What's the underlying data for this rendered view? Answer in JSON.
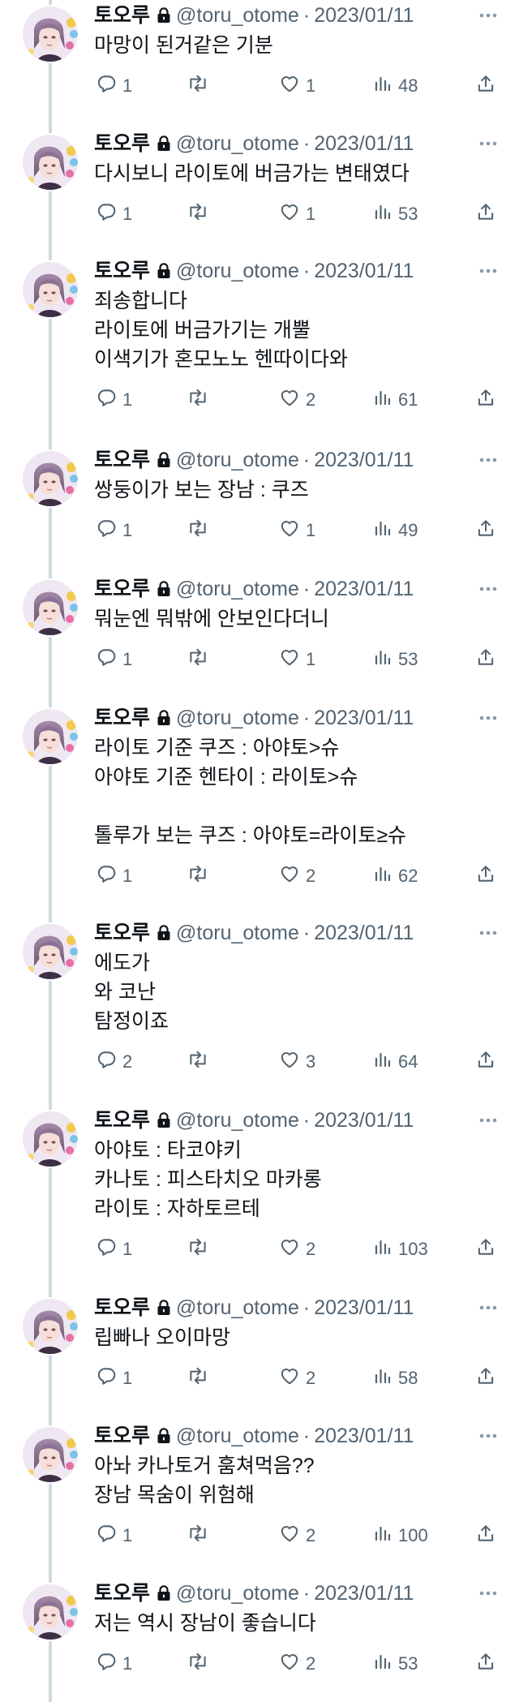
{
  "colors": {
    "text": "#0f1419",
    "secondary": "#536471",
    "thread_line": "#cfd9de",
    "background": "#ffffff"
  },
  "icons": {
    "lock": "lock-icon",
    "more": "more-icon",
    "reply": "reply-icon",
    "retweet": "retweet-icon",
    "like": "heart-icon",
    "views": "views-icon",
    "share": "share-icon"
  },
  "tweets": [
    {
      "name": "토오루",
      "handle": "@toru_otome",
      "sep": "·",
      "date": "2023/01/11",
      "text": "마망이 된거같은 기분",
      "replies": "1",
      "retweets": "",
      "likes": "1",
      "views": "48"
    },
    {
      "name": "토오루",
      "handle": "@toru_otome",
      "sep": "·",
      "date": "2023/01/11",
      "text": "다시보니 라이토에 버금가는 변태였다",
      "replies": "1",
      "retweets": "",
      "likes": "1",
      "views": "53"
    },
    {
      "name": "토오루",
      "handle": "@toru_otome",
      "sep": "·",
      "date": "2023/01/11",
      "text": "죄송합니다\n라이토에 버금가기는 개뿔\n이색기가 혼모노노 헨따이다와",
      "replies": "1",
      "retweets": "",
      "likes": "2",
      "views": "61"
    },
    {
      "name": "토오루",
      "handle": "@toru_otome",
      "sep": "·",
      "date": "2023/01/11",
      "text": "쌍둥이가 보는 장남 : 쿠즈",
      "replies": "1",
      "retweets": "",
      "likes": "1",
      "views": "49"
    },
    {
      "name": "토오루",
      "handle": "@toru_otome",
      "sep": "·",
      "date": "2023/01/11",
      "text": "뭐눈엔 뭐밖에 안보인다더니",
      "replies": "1",
      "retweets": "",
      "likes": "1",
      "views": "53"
    },
    {
      "name": "토오루",
      "handle": "@toru_otome",
      "sep": "·",
      "date": "2023/01/11",
      "text": "라이토 기준 쿠즈 : 아야토>슈\n아야토 기준 헨타이 : 라이토>슈\n\n톨루가 보는 쿠즈 : 아야토=라이토≥슈",
      "replies": "1",
      "retweets": "",
      "likes": "2",
      "views": "62"
    },
    {
      "name": "토오루",
      "handle": "@toru_otome",
      "sep": "·",
      "date": "2023/01/11",
      "text": "에도가\n와 코난\n탐정이죠",
      "replies": "2",
      "retweets": "",
      "likes": "3",
      "views": "64"
    },
    {
      "name": "토오루",
      "handle": "@toru_otome",
      "sep": "·",
      "date": "2023/01/11",
      "text": "아야토 : 타코야키\n카나토 : 피스타치오 마카롱\n라이토 : 자하토르테",
      "replies": "1",
      "retweets": "",
      "likes": "2",
      "views": "103"
    },
    {
      "name": "토오루",
      "handle": "@toru_otome",
      "sep": "·",
      "date": "2023/01/11",
      "text": "립빠나 오이마망",
      "replies": "1",
      "retweets": "",
      "likes": "2",
      "views": "58"
    },
    {
      "name": "토오루",
      "handle": "@toru_otome",
      "sep": "·",
      "date": "2023/01/11",
      "text": "아놔 카나토거 훔쳐먹음??\n장남 목숨이 위험해",
      "replies": "1",
      "retweets": "",
      "likes": "2",
      "views": "100"
    },
    {
      "name": "토오루",
      "handle": "@toru_otome",
      "sep": "·",
      "date": "2023/01/11",
      "text": "저는 역시 장남이 좋습니다",
      "replies": "1",
      "retweets": "",
      "likes": "2",
      "views": "53"
    }
  ]
}
